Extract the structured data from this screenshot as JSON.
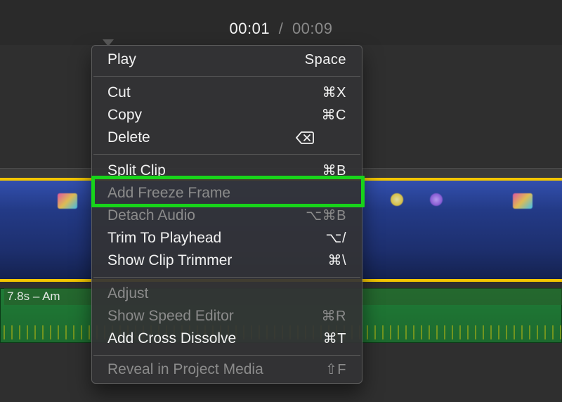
{
  "time": {
    "current": "00:01",
    "separator": "/",
    "total": "00:09"
  },
  "audio": {
    "label": "7.8s – Am"
  },
  "menu": {
    "play": {
      "label": "Play",
      "shortcut": "Space"
    },
    "cut": {
      "label": "Cut",
      "shortcut": "⌘X"
    },
    "copy": {
      "label": "Copy",
      "shortcut": "⌘C"
    },
    "delete": {
      "label": "Delete"
    },
    "split_clip": {
      "label": "Split Clip",
      "shortcut": "⌘B"
    },
    "add_freeze_frame": {
      "label": "Add Freeze Frame"
    },
    "detach_audio": {
      "label": "Detach Audio",
      "shortcut": "⌥⌘B"
    },
    "trim_to_playhead": {
      "label": "Trim To Playhead",
      "shortcut": "⌥/"
    },
    "show_clip_trimmer": {
      "label": "Show Clip Trimmer",
      "shortcut": "⌘\\"
    },
    "adjust": {
      "label": "Adjust"
    },
    "show_speed_editor": {
      "label": "Show Speed Editor",
      "shortcut": "⌘R"
    },
    "add_cross_dissolve": {
      "label": "Add Cross Dissolve",
      "shortcut": "⌘T"
    },
    "reveal_in_project_media": {
      "label": "Reveal in Project Media",
      "shortcut": "⇧F"
    }
  }
}
